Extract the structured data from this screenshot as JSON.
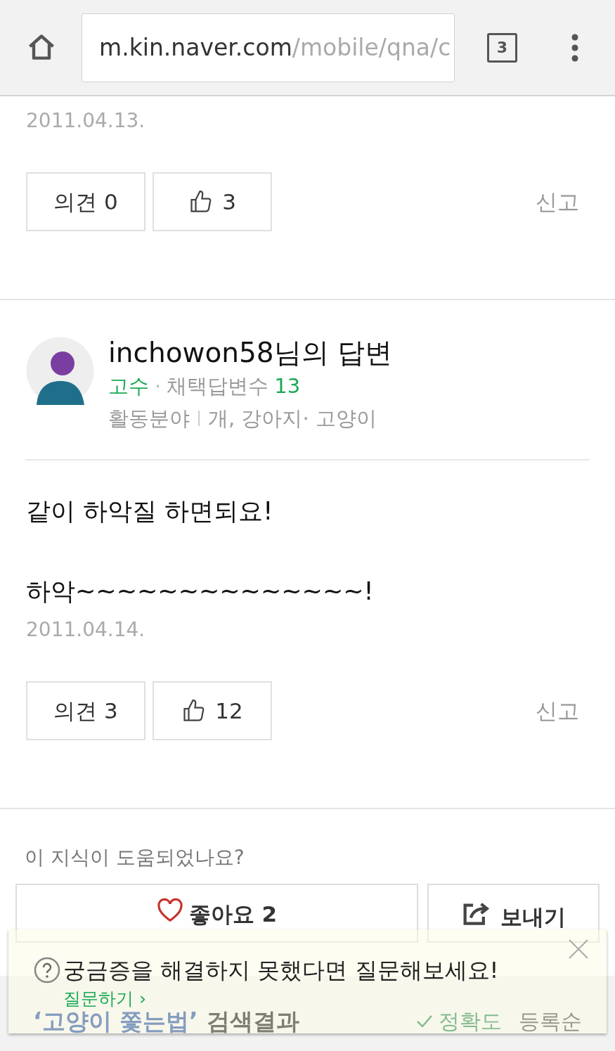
{
  "browser": {
    "url_host": "m.kin.naver.com",
    "url_path": "/mobile/qna/c",
    "tab_count": "3"
  },
  "answers": [
    {
      "date": "2011.04.13.",
      "opinion_label": "의견",
      "opinion_count": "0",
      "likes": "3",
      "report": "신고"
    },
    {
      "author": {
        "name": "inchowon58님의 답변",
        "rank": "고수",
        "separator": "·",
        "adopted_label": "채택답변수",
        "adopted_count": "13",
        "field_label": "활동분야",
        "fields": "개, 강아지· 고양이"
      },
      "body": [
        "같이 하악질 하면되요!",
        "하악~~~~~~~~~~~~~~!"
      ],
      "date": "2011.04.14.",
      "opinion_label": "의견",
      "opinion_count": "3",
      "likes": "12",
      "report": "신고"
    }
  ],
  "feedback": {
    "question": "이 지식이 도움되었나요?",
    "like_label": "좋아요",
    "like_count": "2",
    "share": "보내기"
  },
  "search_results": {
    "query": "‘고양이 쫓는법’",
    "title": "검색결과",
    "sorts": [
      {
        "label": "정확도",
        "selected": true
      },
      {
        "label": "등록순",
        "selected": false
      }
    ]
  },
  "banner": {
    "text": "궁금증을 해결하지 못했다면 질문해보세요!",
    "link": "질문하기 ›"
  }
}
